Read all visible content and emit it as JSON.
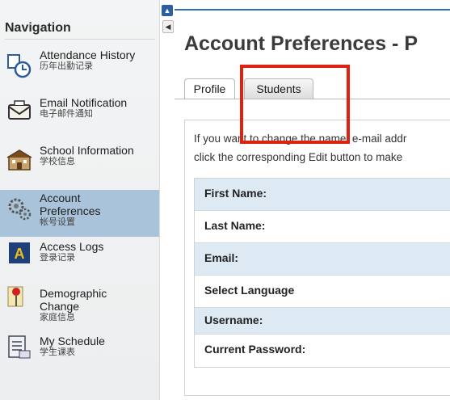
{
  "sidebar": {
    "title": "Navigation",
    "items": [
      {
        "label": "Attendance History",
        "sub": "历年出勤记录",
        "icon": "clock-calendar-icon",
        "active": false
      },
      {
        "label": "Email Notification",
        "sub": "电子邮件通知",
        "icon": "envelope-icon",
        "active": false
      },
      {
        "label": "School Information",
        "sub": "学校信息",
        "icon": "school-building-icon",
        "active": false
      },
      {
        "label": "Account Preferences",
        "sub": "帐号设置",
        "icon": "gears-icon",
        "active": true
      },
      {
        "label": "Access Logs",
        "sub": "登录记录",
        "icon": "access-log-a-icon",
        "active": false
      },
      {
        "label": "Demographic Change",
        "sub": "家庭信息",
        "icon": "map-pin-icon",
        "active": false
      },
      {
        "label": "My Schedule",
        "sub": "学生课表",
        "icon": "schedule-list-icon",
        "active": false
      }
    ]
  },
  "main": {
    "title": "Account Preferences - P",
    "tabs": [
      {
        "label": "Profile",
        "selected": true
      },
      {
        "label": "Students",
        "selected": false
      }
    ],
    "intro_line1": "If you want to change the name, e-mail addr",
    "intro_line2": "click the corresponding Edit button to make",
    "fields": [
      "First Name:",
      "Last Name:",
      "Email:",
      "Select Language",
      "Username:",
      "Current Password:"
    ]
  },
  "colors": {
    "active_nav": "#a9c3da",
    "highlight": "#e02010",
    "row_alt": "#dde9f3",
    "accent": "#2f6fb5"
  }
}
